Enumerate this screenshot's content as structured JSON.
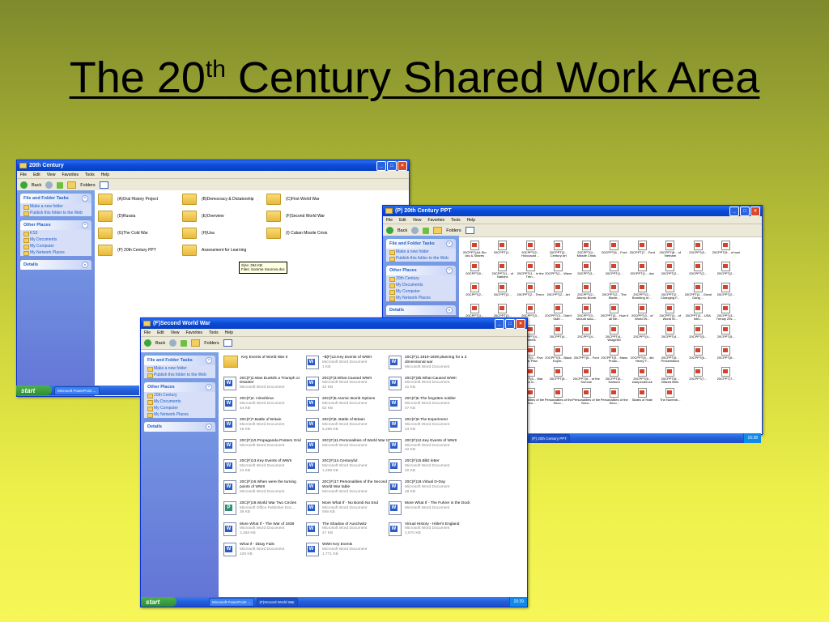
{
  "slide": {
    "title_pre": "The 20",
    "title_sup": "th",
    "title_post": " Century Shared Work Area"
  },
  "menu_items": [
    "File",
    "Edit",
    "View",
    "Favorites",
    "Tools",
    "Help"
  ],
  "toolbar": {
    "back": "Back",
    "folders": "Folders"
  },
  "panes": {
    "file_folder_tasks": "File and Folder Tasks",
    "make_folder": "Make a new folder",
    "publish": "Publish this folder to the Web",
    "other_places": "Other Places",
    "details": "Details",
    "my_documents": "My Documents",
    "my_computer": "My Computer",
    "my_network": "My Network Places"
  },
  "window1": {
    "title": "20th Century",
    "other_places_first": "KS3",
    "folders": [
      "(A)Oral History Project",
      "(B)Democracy & Dictatorship",
      "(C)First World War",
      "(D)Russia",
      "(E)Overview",
      "(F)Second World War",
      "(G)The Cold War",
      "(H)Usa",
      "(I) Cuban Missile Crisis",
      "(P) 20th Century PPT",
      "Assessment for Learning"
    ],
    "tooltip_size": "Size: 294 KB",
    "tooltip_files": "Files: Somme Sources.doc",
    "taskbar_item": "Microsoft PowerPoint ..."
  },
  "window2": {
    "title": "(P) 20th Century PPT",
    "other_places_first": "20th Century",
    "files": [
      "20CPPT(A4-Sto cks & Shares",
      "20CPPT(1...",
      "20CPPT(2... Holocaust ...",
      "20CPPT(3... Century Art",
      "20CPPT(4... Missile Crisis",
      "20CPPT(6... Ford",
      "20CPPT(7... Ford",
      "20CPPT(8... of Vietnam",
      "20CPPT(9...",
      "20CPPT(9... of wwi",
      "20CPPT(9...",
      "20CPPT(1... of Nations",
      "20CPPT(1... in the Tren...",
      "20CPPT(1... Wave",
      "20CPPT(1...",
      "20CPPT(1...",
      "20CPPT(1... doc",
      "20CPPT(2...",
      "20CPPT(2...",
      "20CPPT(2...",
      "20CPPT(2...",
      "20CPPT(2...",
      "20CPPT(2... Terror",
      "20CPPT(2... Art",
      "20CPPT(2... Atomic Bomb",
      "20CPPT(2... The Bizarr...",
      "20CPPT(2... Bombing of ...",
      "20CPPT(2... Changing F...",
      "20CPPT(2... Great Gang ...",
      "20CPPT(2...",
      "20CPPT(3...",
      "20CPPT(3...",
      "20CPPT(3...",
      "20CPPT(3... Didn't Start ...",
      "20CPPT(3... should succ...",
      "20CPPT(3... How it all Be...",
      "20CPPT(3... of World W...",
      "20CPPT(3... of World W...",
      "20CPPT(3... USA Intro...",
      "20CPPT(3... Trendy 20s ...",
      "20CPPT(4...",
      "20CPPT(4... Lotta Bottle!",
      "20CPPT(4... Streets",
      "20CPPT(4...",
      "20CPPT(4...",
      "20CPPT(4... Widgets!!",
      "20CPPT(4...",
      "20CPPT(4...",
      "20CPPT(5...",
      "20CPPT(5...",
      "20CPPT(5... ew Deal",
      "20CPPT(5... & Dictatorship",
      "20CPPT(5... Five Year Plan",
      "20CPPT(5... Black Exper...",
      "20CPPT(5... Ford",
      "20CPPT(5... Mass Produ...",
      "20CPPT(5... did Henry F...",
      "20CPPT(5... Presentation",
      "20CPPT(6...",
      "20CPPT(6...",
      "20CPPT(6... rash",
      "20CPPT(6... Wall Street ...",
      "20CPPT(6... War Two in...",
      "20CPPT(6...",
      "20CPPT(6... of the Somme",
      "20CPPT(6... Harbour",
      "20CPPT(6... Independence",
      "20CPPT(6... Blitzed Brits",
      "20CPPT(7...",
      "20CPPT(7...",
      "s of the d War...",
      "Life in the Trenches WWI",
      "Personalities of the Seco...",
      "Personalities of the Seco...",
      "Personalities of the Seco...",
      "Personalities of the Seco...",
      "States of Hate",
      "The Nuremb..."
    ],
    "taskbar_item": "(P) 20th Century PPT",
    "clock": "16:38"
  },
  "window3": {
    "title": "(F)Second World War",
    "other_places_first": "20th Century",
    "taskbar_items": [
      "Microsoft PowerPoint ...",
      "(F)Second World War"
    ],
    "clock": "16:39",
    "files": [
      {
        "name": "Key Events of World War II",
        "type": "",
        "size": "",
        "icon": "folder"
      },
      {
        "name": "~$(F)12.Key Events of WWII",
        "type": "Microsoft Word Document",
        "size": "1 KB",
        "icon": "word"
      },
      {
        "name": "20C(F)1.1919-1939 planning for a 3 dimensional war",
        "type": "Microsoft Word Document",
        "size": "",
        "icon": "word"
      },
      {
        "name": "20C(F)2.Was Dunkirk a Triumph or Disaster",
        "type": "Microsoft Word Document",
        "size": "",
        "icon": "word"
      },
      {
        "name": "20C(F)3.What Caused WWII",
        "type": "Microsoft Word Document",
        "size": "42 KB",
        "icon": "word"
      },
      {
        "name": "20C(F)3b.What Caused WWII",
        "type": "Microsoft Word Document",
        "size": "41 KB",
        "icon": "word"
      },
      {
        "name": "20C(F)4. Hiroshima",
        "type": "Microsoft Word Document",
        "size": "44 KB",
        "icon": "word"
      },
      {
        "name": "20C(F)5.Atomic Bomb Options",
        "type": "Microsoft Word Document",
        "size": "53 KB",
        "icon": "word"
      },
      {
        "name": "20C(F)6.The forgotten soldier",
        "type": "Microsoft Word Document",
        "size": "47 KB",
        "icon": "word"
      },
      {
        "name": "20C(F)7.Battle of Britain",
        "type": "Microsoft Word Document",
        "size": "19 KB",
        "icon": "word"
      },
      {
        "name": "20C(F)8. Battle of Britain",
        "type": "Microsoft Word Document",
        "size": "5,296 KB",
        "icon": "word"
      },
      {
        "name": "20C(F)9.The Experiment",
        "type": "Microsoft Word Document",
        "size": "23 KB",
        "icon": "word"
      },
      {
        "name": "20C(F)10.Propaganda Posters Grid",
        "type": "Microsoft Word Document",
        "size": "",
        "icon": "word"
      },
      {
        "name": "20C(F)11.Personalities of World War II",
        "type": "Microsoft Word Document",
        "size": "",
        "icon": "word"
      },
      {
        "name": "20C(F)12.Key Events of WWII",
        "type": "Microsoft Word Document",
        "size": "42 KB",
        "icon": "word"
      },
      {
        "name": "20C(F)13.Key Events of WWII",
        "type": "Microsoft Word Document",
        "size": "44 KB",
        "icon": "word"
      },
      {
        "name": "20C(F)14.Centuryful",
        "type": "Microsoft Word Document",
        "size": "1,269 KB",
        "icon": "word"
      },
      {
        "name": "20C(F)15.Blitz letter",
        "type": "Microsoft Word Document",
        "size": "20 KB",
        "icon": "word"
      },
      {
        "name": "20C(F)16.When were the turning points of WWII",
        "type": "Microsoft Word Document",
        "size": "",
        "icon": "word"
      },
      {
        "name": "20C(F)17.Personalities of the Second World War table",
        "type": "Microsoft Word Document",
        "size": "",
        "icon": "word"
      },
      {
        "name": "20C(F)18.Virtual D-Day",
        "type": "Microsoft Word Document",
        "size": "48 KB",
        "icon": "word"
      },
      {
        "name": "20C(F)19.World War Two Circles",
        "type": "Microsoft Office Publisher Doc...",
        "size": "39 KB",
        "icon": "pub"
      },
      {
        "name": "More What If - No Bomb No End",
        "type": "Microsoft Word Document",
        "size": "946 KB",
        "icon": "word"
      },
      {
        "name": "More What If - The Fuhrer in the Dock",
        "type": "Microsoft Word Document",
        "size": "",
        "icon": "word"
      },
      {
        "name": "More What If - The War of 1938",
        "type": "Microsoft Word Document",
        "size": "3,468 KB",
        "icon": "word"
      },
      {
        "name": "The Shadow of Auschwitz",
        "type": "Microsoft Word Document",
        "size": "47 KB",
        "icon": "word"
      },
      {
        "name": "Virtual History - Hitler's England",
        "type": "Microsoft Word Document",
        "size": "2,670 KB",
        "icon": "word"
      },
      {
        "name": "What If - DDay Fails",
        "type": "Microsoft Word Document",
        "size": "428 KB",
        "icon": "word"
      },
      {
        "name": "WWII Key Events",
        "type": "Microsoft Word Document",
        "size": "1,771 KB",
        "icon": "word"
      }
    ]
  },
  "start_label": "start"
}
